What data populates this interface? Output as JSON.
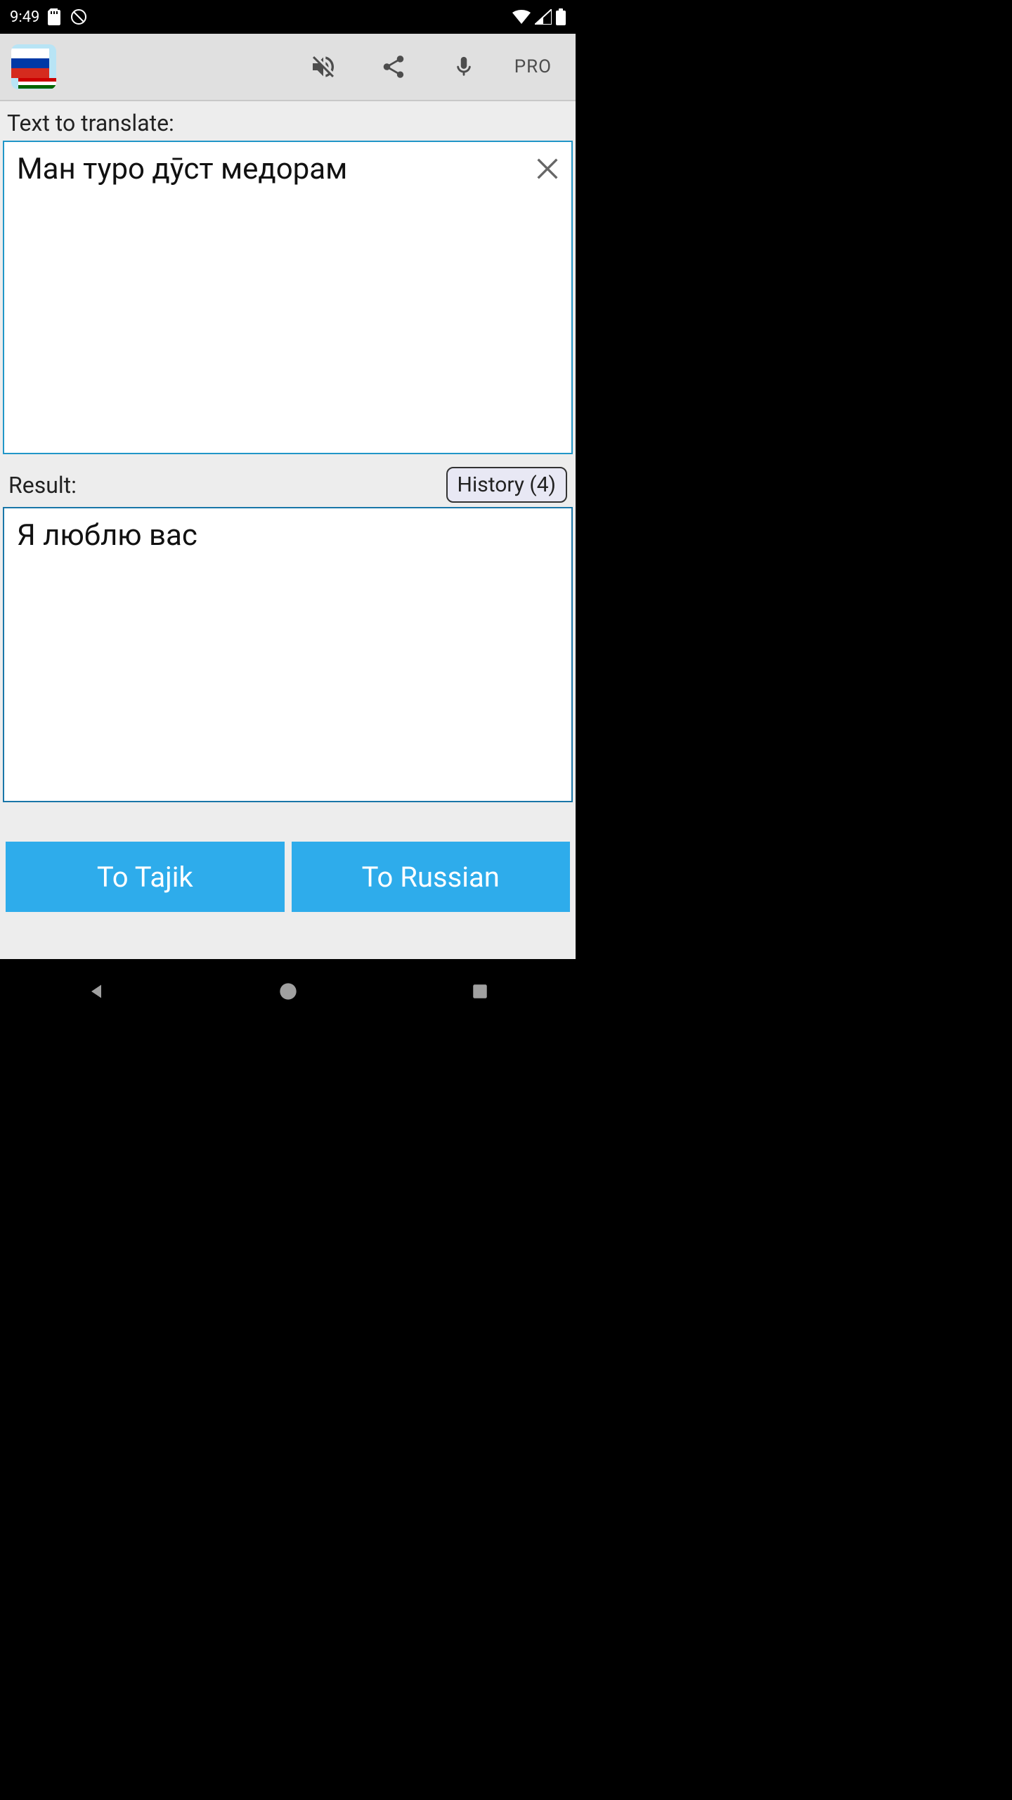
{
  "status": {
    "time": "9:49"
  },
  "toolbar": {
    "pro_label": "PRO"
  },
  "labels": {
    "text_to_translate": "Text to translate:",
    "result": "Result:",
    "history": "History (4)"
  },
  "input": {
    "text": "Ман туро дӯст медорам"
  },
  "result": {
    "text": "Я люблю вас"
  },
  "buttons": {
    "to_tajik": "To Tajik",
    "to_russian": "To Russian"
  }
}
